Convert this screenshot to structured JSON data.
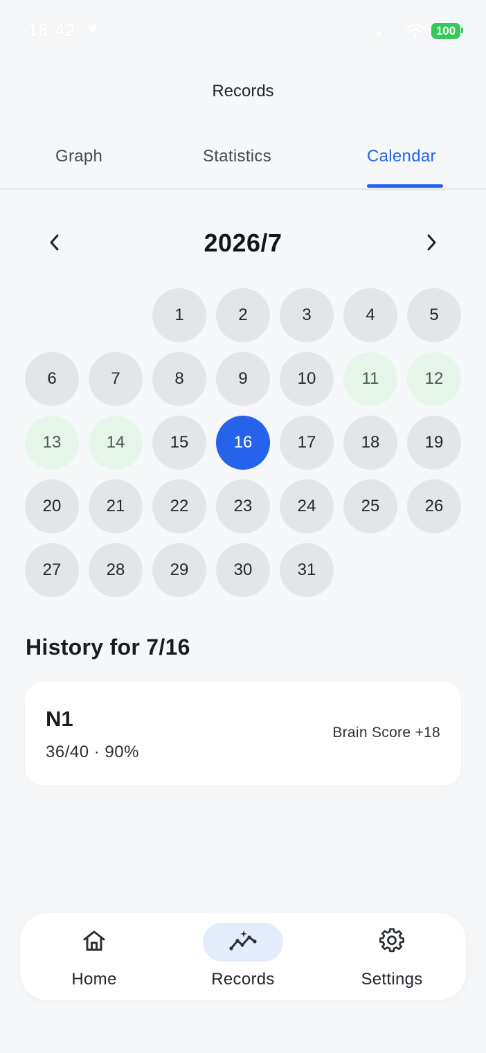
{
  "status_bar": {
    "time": "16:42",
    "battery": "100"
  },
  "header": {
    "title": "Records"
  },
  "tabs": [
    {
      "label": "Graph"
    },
    {
      "label": "Statistics"
    },
    {
      "label": "Calendar",
      "active": true
    }
  ],
  "calendar": {
    "month_title": "2026/7",
    "leading_blanks": 2,
    "days": [
      "1",
      "2",
      "3",
      "4",
      "5",
      "6",
      "7",
      "8",
      "9",
      "10",
      "11",
      "12",
      "13",
      "14",
      "15",
      "16",
      "17",
      "18",
      "19",
      "20",
      "21",
      "22",
      "23",
      "24",
      "25",
      "26",
      "27",
      "28",
      "29",
      "30",
      "31"
    ],
    "days_with_records": [
      "11",
      "12",
      "13",
      "14"
    ],
    "selected_day": "16"
  },
  "history": {
    "title": "History for 7/16",
    "records": [
      {
        "name": "N1",
        "score": "36/40 · 90%",
        "brain_score": "Brain Score +18"
      }
    ]
  },
  "bottom_nav": {
    "items": [
      {
        "label": "Home",
        "icon": "home-icon"
      },
      {
        "label": "Records",
        "icon": "chart-sparkle-icon",
        "active": true
      },
      {
        "label": "Settings",
        "icon": "gear-icon"
      }
    ]
  },
  "colors": {
    "accent": "#2563eb",
    "record_day_bg": "#e6f5ea",
    "day_bg": "#e4e5e8",
    "active_nav_bg": "#e4ecfb",
    "battery": "#34c759"
  }
}
